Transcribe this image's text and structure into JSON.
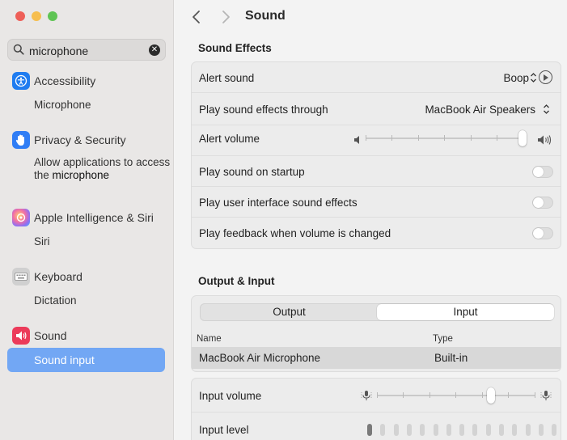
{
  "window": {
    "title": "Sound"
  },
  "search": {
    "value": "microphone"
  },
  "sidebar": {
    "categories": [
      {
        "label": "Accessibility",
        "icon": "accessibility-icon",
        "color": "#1f7cf0",
        "results": [
          "Microphone"
        ]
      },
      {
        "label": "Privacy & Security",
        "icon": "hand-icon",
        "color": "#2f7df5",
        "results_prefix": "Allow applications to access the ",
        "results_highlight": "microphone"
      },
      {
        "label": "Apple Intelligence & Siri",
        "icon": "siri-icon",
        "results": [
          "Siri"
        ]
      },
      {
        "label": "Keyboard",
        "icon": "keyboard-icon",
        "color": "#b9b9b9",
        "results": [
          "Dictation"
        ]
      },
      {
        "label": "Sound",
        "icon": "speaker-icon",
        "color": "#ec3b5a",
        "results": [
          "Sound input"
        ]
      }
    ],
    "selected_result": "Sound input"
  },
  "sound_effects": {
    "heading": "Sound Effects",
    "alert_sound": {
      "label": "Alert sound",
      "value": "Boop"
    },
    "play_through": {
      "label": "Play sound effects through",
      "value": "MacBook Air Speakers"
    },
    "alert_volume": {
      "label": "Alert volume",
      "level": 1.0
    },
    "startup": {
      "label": "Play sound on startup",
      "on": false
    },
    "ui_effects": {
      "label": "Play user interface sound effects",
      "on": false
    },
    "feedback": {
      "label": "Play feedback when volume is changed",
      "on": false
    }
  },
  "output_input": {
    "heading": "Output & Input",
    "tabs": [
      "Output",
      "Input"
    ],
    "selected_tab": "Input",
    "columns": [
      "Name",
      "Type"
    ],
    "devices": [
      {
        "name": "MacBook Air Microphone",
        "type": "Built-in"
      }
    ],
    "input_volume": {
      "label": "Input volume",
      "level": 0.7
    },
    "input_level": {
      "label": "Input level",
      "active_bars": 1,
      "total_bars": 15
    }
  },
  "colors": {
    "accent": "#72a7f4"
  }
}
